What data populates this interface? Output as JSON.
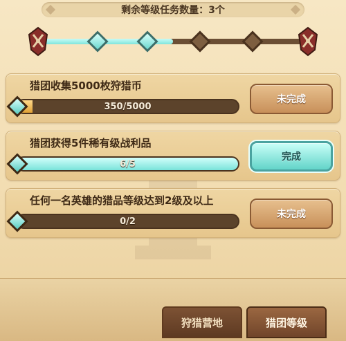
{
  "header": {
    "remaining_text": "剩余等级任务数量：3个"
  },
  "level_track": {
    "nodes_total": 5,
    "nodes_done": 3
  },
  "tasks": [
    {
      "title": "猎团收集5000枚狩猎币",
      "progress_text": "350/5000",
      "progress": 0.07,
      "button_label": "未完成",
      "status": "incomplete"
    },
    {
      "title": "猎团获得5件稀有级战利品",
      "progress_text": "6/5",
      "progress": 1.0,
      "button_label": "完成",
      "status": "complete"
    },
    {
      "title": "任何一名英雄的猎品等级达到2级及以上",
      "progress_text": "0/2",
      "progress": 0.0,
      "button_label": "未完成",
      "status": "incomplete"
    }
  ],
  "tabs": [
    {
      "label": "狩猎营地",
      "active": false
    },
    {
      "label": "猎团等级",
      "active": true
    }
  ],
  "colors": {
    "accent_teal": "#7fe5dc",
    "button_brown": "#c8905a",
    "bar_dark": "#5c432b"
  }
}
